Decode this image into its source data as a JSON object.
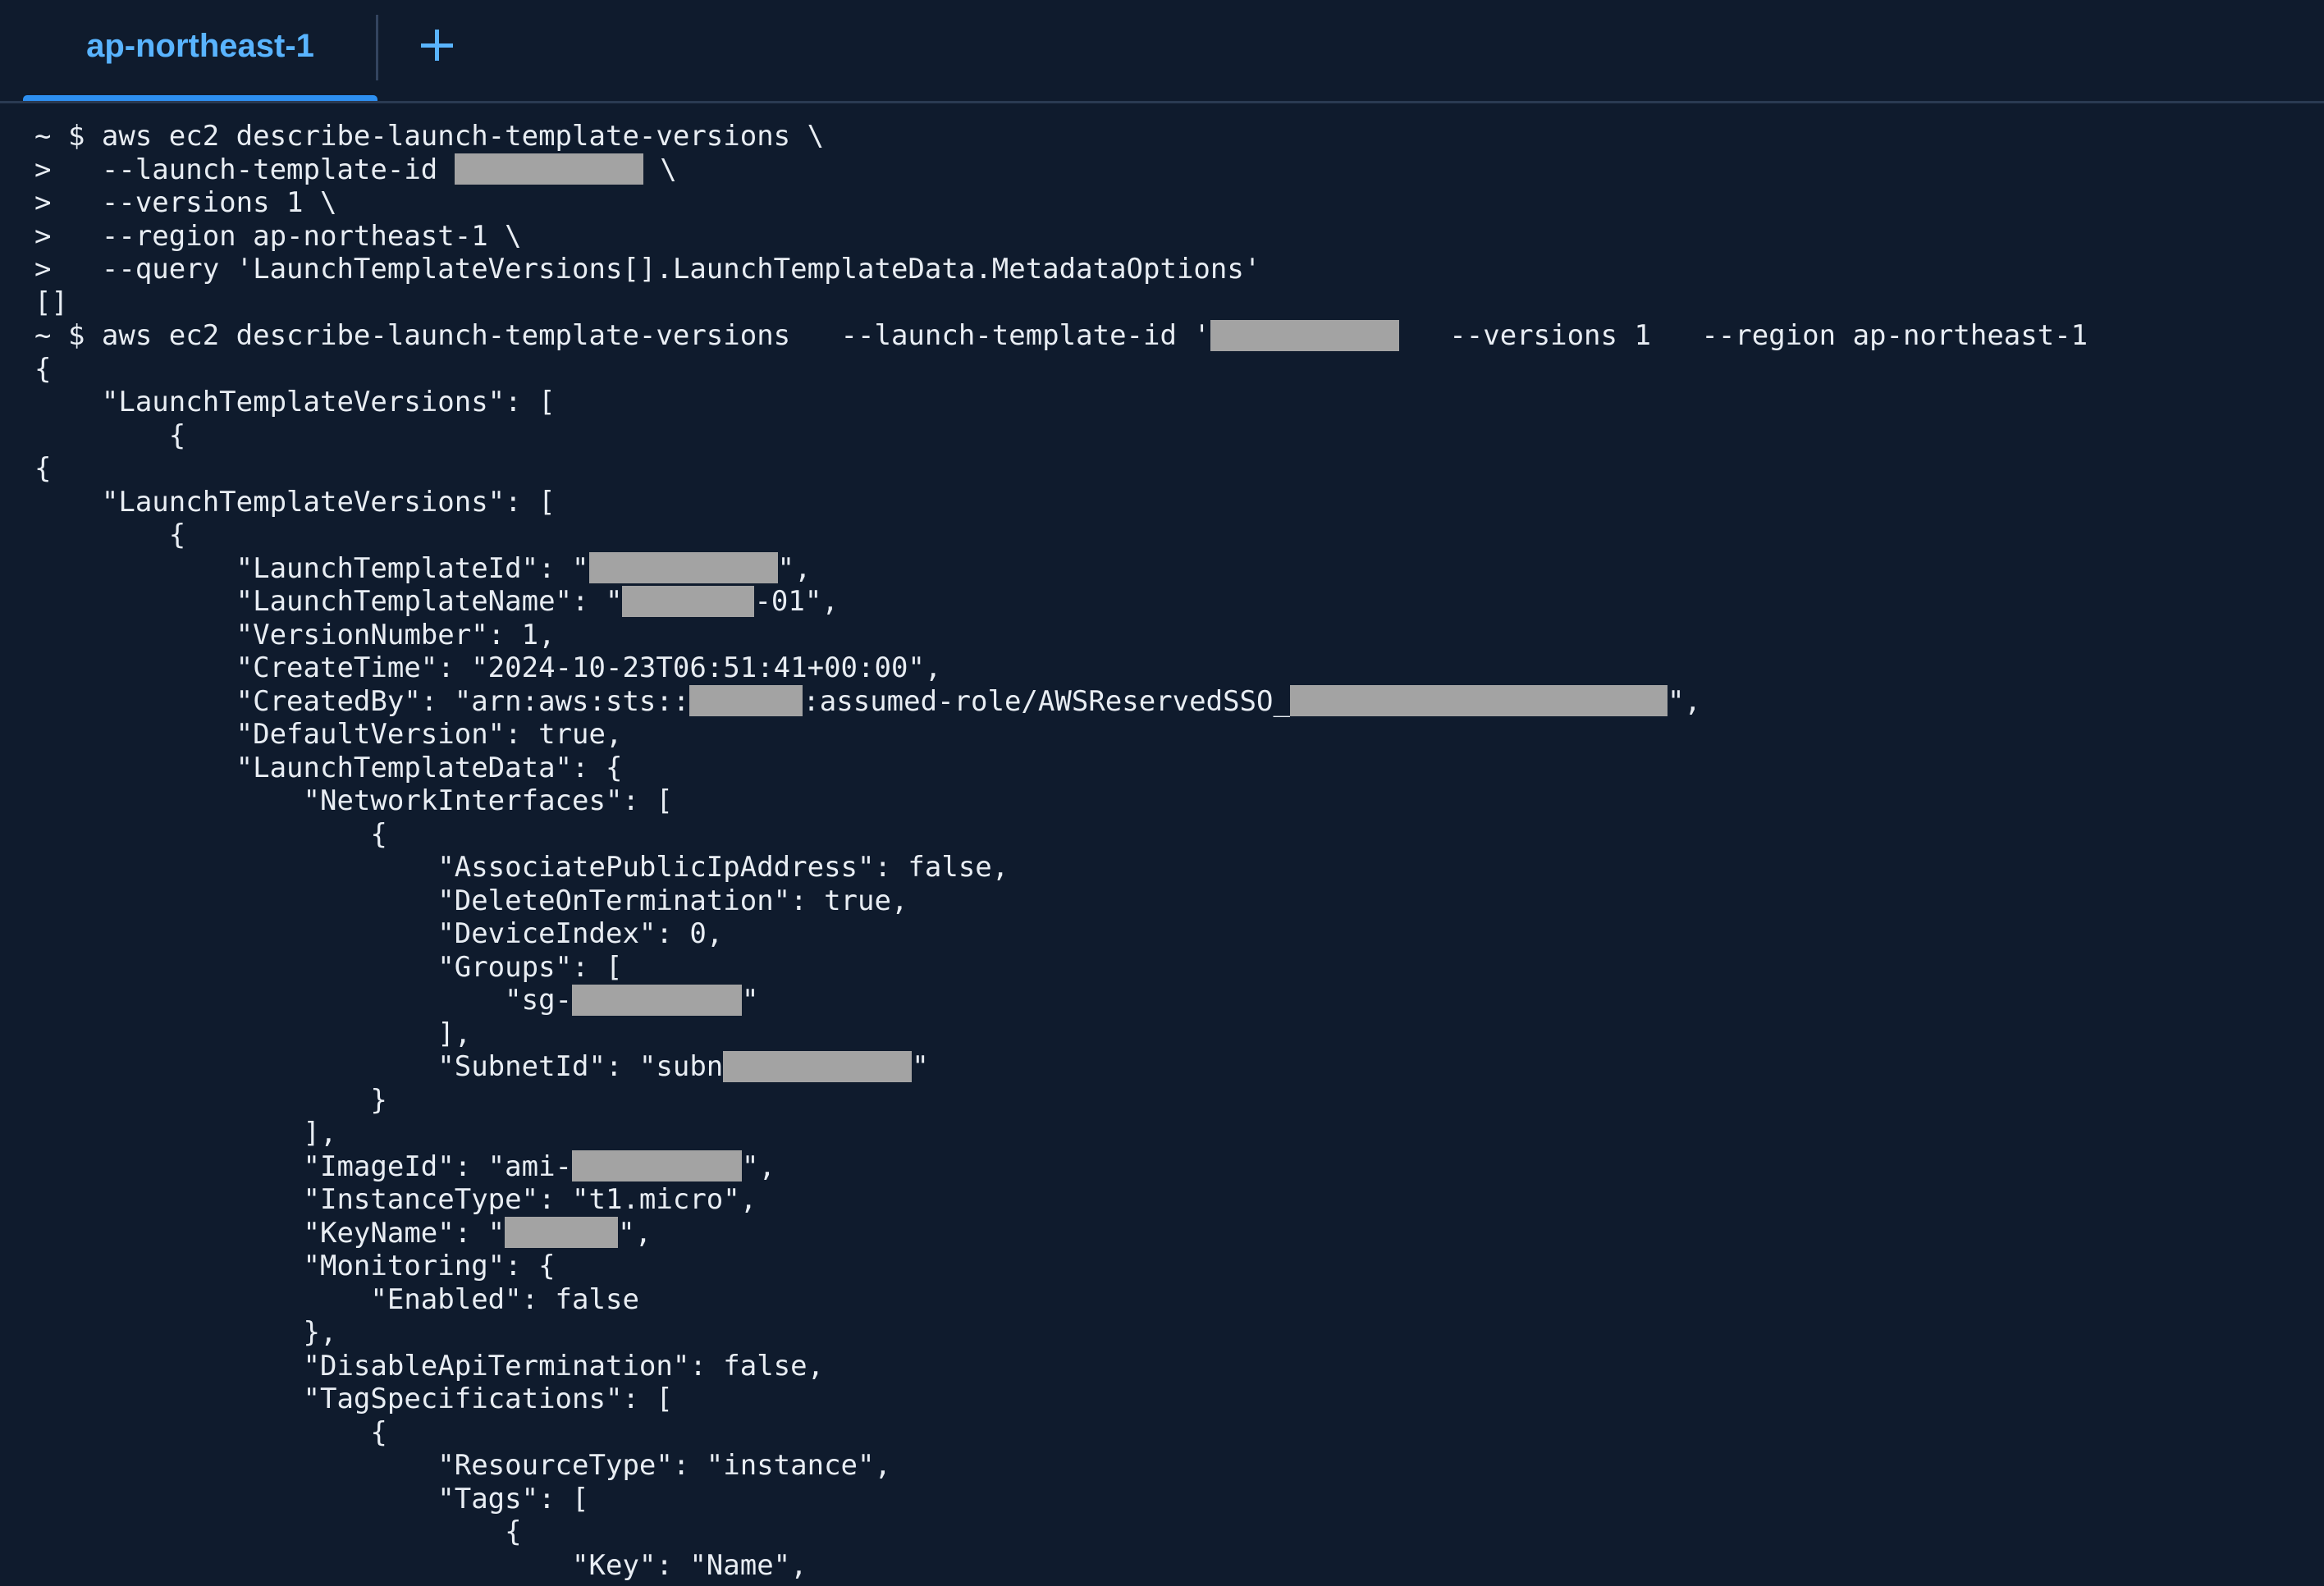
{
  "tabs": [
    {
      "label": "ap-northeast-1",
      "active": true
    }
  ],
  "new_tab_icon": "plus-icon",
  "colors": {
    "background": "#0f1b2d",
    "tab_active_text": "#59b4ff",
    "tab_underline": "#2d8ff0",
    "terminal_text": "#e8edf3",
    "redaction": "#a3a3a3"
  },
  "terminal": {
    "lines": [
      {
        "segments": [
          {
            "type": "text",
            "text": "~ $ aws ec2 describe-launch-template-versions \\"
          }
        ]
      },
      {
        "segments": [
          {
            "type": "text",
            "text": ">   --launch-template-id "
          },
          {
            "type": "redact",
            "chars": 10
          },
          {
            "type": "text",
            "text": " \\"
          }
        ]
      },
      {
        "segments": [
          {
            "type": "text",
            "text": ">   --versions 1 \\"
          }
        ]
      },
      {
        "segments": [
          {
            "type": "text",
            "text": ">   --region ap-northeast-1 \\"
          }
        ]
      },
      {
        "segments": [
          {
            "type": "text",
            "text": ">   --query 'LaunchTemplateVersions[].LaunchTemplateData.MetadataOptions'"
          }
        ]
      },
      {
        "segments": [
          {
            "type": "text",
            "text": "[]"
          }
        ]
      },
      {
        "segments": [
          {
            "type": "text",
            "text": "~ $ aws ec2 describe-launch-template-versions   --launch-template-id '"
          },
          {
            "type": "redact",
            "chars": 10
          },
          {
            "type": "text",
            "text": "   --versions 1   --region ap-northeast-1"
          }
        ]
      },
      {
        "segments": [
          {
            "type": "text",
            "text": "{"
          }
        ]
      },
      {
        "segments": [
          {
            "type": "text",
            "text": "    \"LaunchTemplateVersions\": ["
          }
        ]
      },
      {
        "segments": [
          {
            "type": "text",
            "text": "        {"
          }
        ]
      },
      {
        "segments": [
          {
            "type": "text",
            "text": "{"
          }
        ]
      },
      {
        "segments": [
          {
            "type": "text",
            "text": "    \"LaunchTemplateVersions\": ["
          }
        ]
      },
      {
        "segments": [
          {
            "type": "text",
            "text": "        {"
          }
        ]
      },
      {
        "segments": [
          {
            "type": "text",
            "text": "            \"LaunchTemplateId\": \""
          },
          {
            "type": "redact",
            "chars": 10
          },
          {
            "type": "text",
            "text": "\","
          }
        ]
      },
      {
        "segments": [
          {
            "type": "text",
            "text": "            \"LaunchTemplateName\": \""
          },
          {
            "type": "redact",
            "chars": 7
          },
          {
            "type": "text",
            "text": "-01\","
          }
        ]
      },
      {
        "segments": [
          {
            "type": "text",
            "text": "            \"VersionNumber\": 1,"
          }
        ]
      },
      {
        "segments": [
          {
            "type": "text",
            "text": "            \"CreateTime\": \"2024-10-23T06:51:41+00:00\","
          }
        ]
      },
      {
        "segments": [
          {
            "type": "text",
            "text": "            \"CreatedBy\": \"arn:aws:sts::"
          },
          {
            "type": "redact",
            "chars": 6
          },
          {
            "type": "text",
            "text": ":assumed-role/AWSReservedSSO_"
          },
          {
            "type": "redact",
            "chars": 20
          },
          {
            "type": "text",
            "text": "\","
          }
        ]
      },
      {
        "segments": [
          {
            "type": "text",
            "text": "            \"DefaultVersion\": true,"
          }
        ]
      },
      {
        "segments": [
          {
            "type": "text",
            "text": "            \"LaunchTemplateData\": {"
          }
        ]
      },
      {
        "segments": [
          {
            "type": "text",
            "text": "                \"NetworkInterfaces\": ["
          }
        ]
      },
      {
        "segments": [
          {
            "type": "text",
            "text": "                    {"
          }
        ]
      },
      {
        "segments": [
          {
            "type": "text",
            "text": "                        \"AssociatePublicIpAddress\": false,"
          }
        ]
      },
      {
        "segments": [
          {
            "type": "text",
            "text": "                        \"DeleteOnTermination\": true,"
          }
        ]
      },
      {
        "segments": [
          {
            "type": "text",
            "text": "                        \"DeviceIndex\": 0,"
          }
        ]
      },
      {
        "segments": [
          {
            "type": "text",
            "text": "                        \"Groups\": ["
          }
        ]
      },
      {
        "segments": [
          {
            "type": "text",
            "text": "                            \"sg-"
          },
          {
            "type": "redact",
            "chars": 9
          },
          {
            "type": "text",
            "text": "\""
          }
        ]
      },
      {
        "segments": [
          {
            "type": "text",
            "text": "                        ],"
          }
        ]
      },
      {
        "segments": [
          {
            "type": "text",
            "text": "                        \"SubnetId\": \"subn"
          },
          {
            "type": "redact",
            "chars": 10
          },
          {
            "type": "text",
            "text": "\""
          }
        ]
      },
      {
        "segments": [
          {
            "type": "text",
            "text": "                    }"
          }
        ]
      },
      {
        "segments": [
          {
            "type": "text",
            "text": "                ],"
          }
        ]
      },
      {
        "segments": [
          {
            "type": "text",
            "text": "                \"ImageId\": \"ami-"
          },
          {
            "type": "redact",
            "chars": 9
          },
          {
            "type": "text",
            "text": "\","
          }
        ]
      },
      {
        "segments": [
          {
            "type": "text",
            "text": "                \"InstanceType\": \"t1.micro\","
          }
        ]
      },
      {
        "segments": [
          {
            "type": "text",
            "text": "                \"KeyName\": \""
          },
          {
            "type": "redact",
            "chars": 6
          },
          {
            "type": "text",
            "text": "\","
          }
        ]
      },
      {
        "segments": [
          {
            "type": "text",
            "text": "                \"Monitoring\": {"
          }
        ]
      },
      {
        "segments": [
          {
            "type": "text",
            "text": "                    \"Enabled\": false"
          }
        ]
      },
      {
        "segments": [
          {
            "type": "text",
            "text": "                },"
          }
        ]
      },
      {
        "segments": [
          {
            "type": "text",
            "text": "                \"DisableApiTermination\": false,"
          }
        ]
      },
      {
        "segments": [
          {
            "type": "text",
            "text": "                \"TagSpecifications\": ["
          }
        ]
      },
      {
        "segments": [
          {
            "type": "text",
            "text": "                    {"
          }
        ]
      },
      {
        "segments": [
          {
            "type": "text",
            "text": "                        \"ResourceType\": \"instance\","
          }
        ]
      },
      {
        "segments": [
          {
            "type": "text",
            "text": "                        \"Tags\": ["
          }
        ]
      },
      {
        "segments": [
          {
            "type": "text",
            "text": "                            {"
          }
        ]
      },
      {
        "segments": [
          {
            "type": "text",
            "text": "                                \"Key\": \"Name\","
          }
        ]
      }
    ]
  }
}
